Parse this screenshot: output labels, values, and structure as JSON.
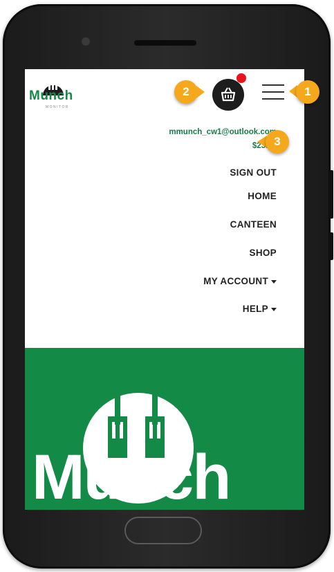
{
  "header": {
    "logo_text": "Munch",
    "logo_subtext": "MONITOR",
    "basket_icon": "basket-icon",
    "menu_icon": "hamburger-menu-icon"
  },
  "account": {
    "email": "mmunch_cw1@outlook.com",
    "balance": "$23.50"
  },
  "menu": {
    "items": [
      {
        "label": "SIGN OUT",
        "dropdown": false
      },
      {
        "label": "HOME",
        "dropdown": false
      },
      {
        "label": "CANTEEN",
        "dropdown": false
      },
      {
        "label": "SHOP",
        "dropdown": false
      },
      {
        "label": "MY ACCOUNT",
        "dropdown": true
      },
      {
        "label": "HELP",
        "dropdown": true
      }
    ]
  },
  "banner": {
    "logo_text": "Munch"
  },
  "callouts": [
    "1",
    "2",
    "3"
  ],
  "colors": {
    "brand_green": "#138a46",
    "callout_orange": "#f5a81c",
    "notification_red": "#e8141c"
  }
}
